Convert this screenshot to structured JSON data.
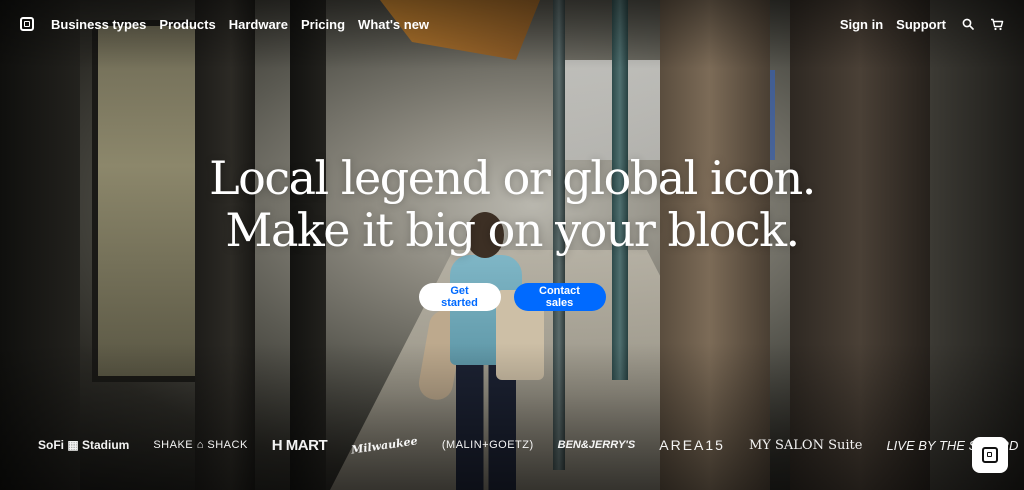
{
  "nav": {
    "items": [
      {
        "label": "Business types"
      },
      {
        "label": "Products"
      },
      {
        "label": "Hardware"
      },
      {
        "label": "Pricing"
      },
      {
        "label": "What's new"
      }
    ],
    "sign_in": "Sign in",
    "support": "Support",
    "search_icon": "search-icon",
    "cart_icon": "cart-icon",
    "logo_icon": "square-logo-icon"
  },
  "hero": {
    "headline_line1": "Local legend or global icon.",
    "headline_line2": "Make it big on your block.",
    "primary_cta": "Get started",
    "secondary_cta": "Contact sales"
  },
  "brands": [
    "SoFi ▦ Stadium",
    "SHAKE ⌂ SHACK",
    "H MART",
    "Milwaukee",
    "(MALIN+GOETZ)",
    "BEN&JERRY'S",
    "AREA15",
    "MY SALON Suite",
    "LIVE BY THE SWORD",
    "❧"
  ],
  "colors": {
    "brand_blue": "#006aff",
    "text": "#ffffff"
  }
}
